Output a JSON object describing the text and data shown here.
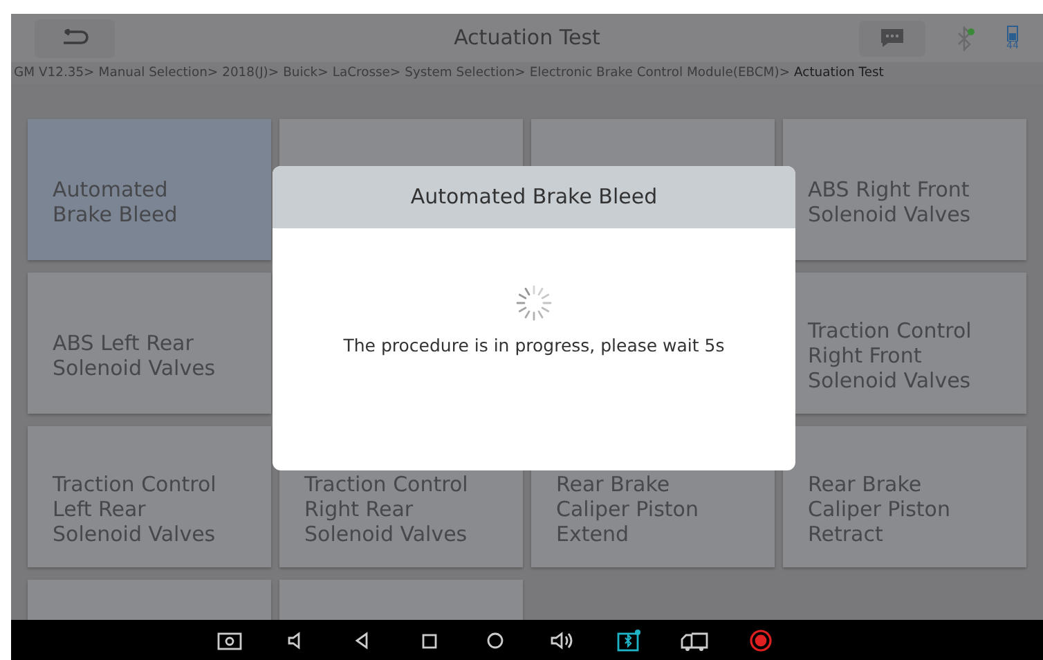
{
  "header": {
    "title": "Actuation Test",
    "battery": "44"
  },
  "breadcrumb": [
    {
      "label": "GM V12.35>",
      "current": false
    },
    {
      "label": "Manual Selection>",
      "current": false
    },
    {
      "label": "2018(J)>",
      "current": false
    },
    {
      "label": "Buick>",
      "current": false
    },
    {
      "label": "LaCrosse>",
      "current": false
    },
    {
      "label": "System Selection>",
      "current": false
    },
    {
      "label": "Electronic Brake Control Module(EBCM)>",
      "current": false
    },
    {
      "label": "Actuation Test",
      "current": true
    }
  ],
  "tiles": [
    {
      "label": "Automated\nBrake Bleed",
      "selected": true
    },
    {
      "selected": false
    },
    {
      "selected": false
    },
    {
      "label": "ABS Right Front\nSolenoid Valves",
      "selected": false
    },
    {
      "label": "ABS Left Rear\nSolenoid Valves",
      "selected": false
    },
    {
      "label": "Traction Control\nRight Front\nSolenoid Valves",
      "selected": false
    },
    {
      "label": "Traction Control\nLeft Rear\nSolenoid Valves",
      "selected": false
    },
    {
      "label": "Traction Control\nRight Rear\nSolenoid Valves",
      "selected": false
    },
    {
      "label": "Rear Brake\nCaliper Piston\nExtend",
      "selected": false
    },
    {
      "label": "Rear Brake\nCaliper Piston\nRetract",
      "selected": false
    },
    {
      "selected": false
    },
    {
      "selected": false
    }
  ],
  "dialog": {
    "title": "Automated Brake Bleed",
    "message": "The procedure is in progress, please wait 5s"
  },
  "nav_bar": [
    {
      "kind": "screenshot"
    },
    {
      "kind": "volume-down"
    },
    {
      "kind": "back"
    },
    {
      "kind": "recents"
    },
    {
      "kind": "home"
    },
    {
      "kind": "volume-up"
    },
    {
      "kind": "vci"
    },
    {
      "kind": "truck"
    },
    {
      "kind": "record"
    }
  ]
}
